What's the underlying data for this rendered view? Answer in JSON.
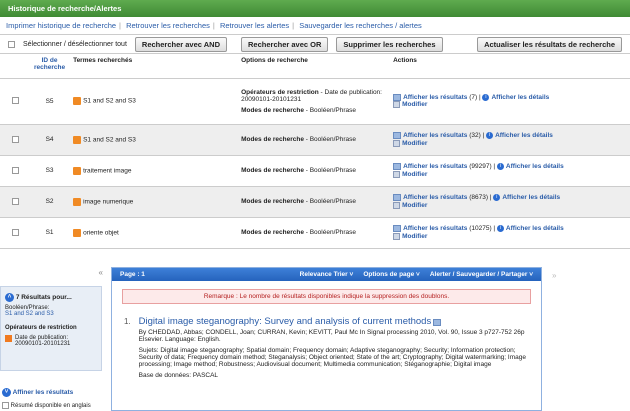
{
  "history": {
    "title": "Historique de recherche/Alertes",
    "links": [
      "Imprimer historique de recherche",
      "Retrouver les recherches",
      "Retrouver les alertes",
      "Sauvegarder les recherches / alertes"
    ],
    "select_all": "Sélectionner / désélectionner tout",
    "buttons": {
      "and": "Rechercher avec AND",
      "or": "Rechercher avec OR",
      "delete": "Supprimer les recherches",
      "refresh": "Actualiser les résultats de recherche"
    },
    "columns": {
      "id": "ID de recherche",
      "terms": "Termes recherchés",
      "options": "Options de recherche",
      "actions": "Actions"
    },
    "rows": [
      {
        "id": "S5",
        "term": "S1 and S2 and S3",
        "opt1_label": "Opérateurs de restriction",
        "opt1_value": " - Date de publication: 20090101-20101231",
        "mode_label": "Modes de recherche",
        "mode_value": " - Booléen/Phrase",
        "show": "Afficher les résultats",
        "count": "(7)",
        "details": "Afficher les détails",
        "edit": "Modifier"
      },
      {
        "id": "S4",
        "term": "S1 and S2 and S3",
        "mode_label": "Modes de recherche",
        "mode_value": " - Booléen/Phrase",
        "show": "Afficher les résultats",
        "count": "(32)",
        "details": "Afficher les détails",
        "edit": "Modifier"
      },
      {
        "id": "S3",
        "term": "traitement image",
        "mode_label": "Modes de recherche",
        "mode_value": " - Booléen/Phrase",
        "show": "Afficher les résultats",
        "count": "(99297)",
        "details": "Afficher les détails",
        "edit": "Modifier"
      },
      {
        "id": "S2",
        "term": "image numerique",
        "mode_label": "Modes de recherche",
        "mode_value": " - Booléen/Phrase",
        "show": "Afficher les résultats",
        "count": "(8673)",
        "details": "Afficher les détails",
        "edit": "Modifier"
      },
      {
        "id": "S1",
        "term": "oriente objet",
        "mode_label": "Modes de recherche",
        "mode_value": " - Booléen/Phrase",
        "show": "Afficher les résultats",
        "count": "(10275)",
        "details": "Afficher les détails",
        "edit": "Modifier"
      }
    ]
  },
  "sidebar": {
    "results_title": "7 Résultats pour...",
    "mode": "Booléen/Phrase:",
    "query": "S1 and S2 and S3",
    "restriction_title": "Opérateurs de restriction",
    "restriction_value": "Date de publication: 20090101-20101231",
    "refine": "Affiner les résultats",
    "option": "Résumé disponible en anglais"
  },
  "results": {
    "page": "Page : 1",
    "sort": "Relevance Trier",
    "page_options": "Options de page",
    "alert": "Alerter / Sauvegarder / Partager",
    "notice": "Remarque : Le nombre de résultats disponibles indique la suppression des doublons.",
    "item": {
      "num": "1.",
      "title": "Digital image steganography: Survey and analysis of current methods",
      "authors": "By CHEDDAD, Abbas; CONDELL, Joan; CURRAN, Kevin; KEVITT, Paul Mc In Signal processing 2010, Vol. 90, Issue 3 p727-752 26p",
      "publisher": "Elsevier. Language: English.",
      "subjects": "Sujets: Digital image steganography; Spatial domain; Frequency domain; Adaptive steganography; Security; Information protection; Security of data; Frequency domain method; Steganalysis; Object oriented; State of the art; Cryptography; Digital watermarking; Image processing; Image method; Robustness; Audiovisual document; Multimedia communication; Stéganographie; Digital image",
      "db": "Base de données: PASCAL"
    }
  }
}
